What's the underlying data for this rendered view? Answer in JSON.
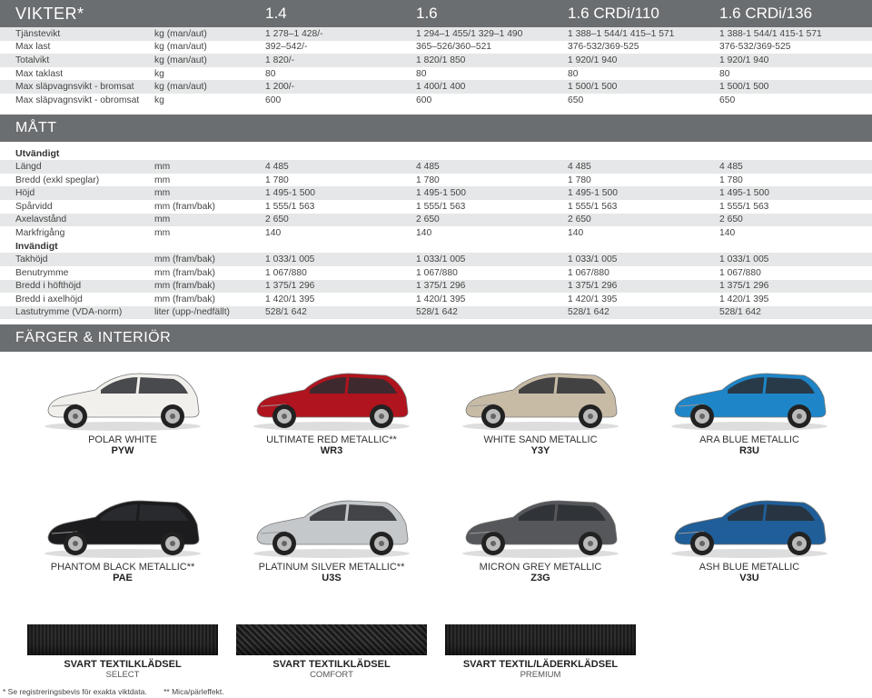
{
  "weights": {
    "title": "VIKTER*",
    "columns": [
      "1.4",
      "1.6",
      "1.6 CRDi/110",
      "1.6 CRDi/136"
    ],
    "rows": [
      [
        "Tjänstevikt",
        "kg (man/aut)",
        "1 278–1 428/-",
        "1 294–1 455/1 329–1 490",
        "1 388–1 544/1 415–1 571",
        "1 388-1 544/1 415-1 571"
      ],
      [
        "Max last",
        "kg (man/aut)",
        "392–542/-",
        "365–526/360–521",
        "376-532/369-525",
        "376-532/369-525"
      ],
      [
        "Totalvikt",
        "kg (man/aut)",
        "1 820/-",
        "1 820/1 850",
        "1 920/1 940",
        "1 920/1 940"
      ],
      [
        "Max taklast",
        "kg",
        "80",
        "80",
        "80",
        "80"
      ],
      [
        "Max släpvagnsvikt - bromsat",
        "kg (man/aut)",
        "1 200/-",
        "1 400/1 400",
        "1 500/1 500",
        "1 500/1 500"
      ],
      [
        "Max släpvagnsvikt - obromsat",
        "kg",
        "600",
        "600",
        "650",
        "650"
      ]
    ]
  },
  "dimensions": {
    "title": "MÅTT",
    "exterior_label": "Utvändigt",
    "exterior": [
      [
        "Längd",
        "mm",
        "4 485",
        "4 485",
        "4 485",
        "4 485"
      ],
      [
        "Bredd (exkl speglar)",
        "mm",
        "1 780",
        "1 780",
        "1 780",
        "1 780"
      ],
      [
        "Höjd",
        "mm",
        "1 495-1 500",
        "1 495-1 500",
        "1 495-1 500",
        "1 495-1 500"
      ],
      [
        "Spårvidd",
        "mm (fram/bak)",
        "1 555/1 563",
        "1 555/1 563",
        "1 555/1 563",
        "1 555/1 563"
      ],
      [
        "Axelavstånd",
        "mm",
        "2 650",
        "2 650",
        "2 650",
        "2 650"
      ],
      [
        "Markfrigång",
        "mm",
        "140",
        "140",
        "140",
        "140"
      ]
    ],
    "interior_label": "Invändigt",
    "interior": [
      [
        "Takhöjd",
        "mm (fram/bak)",
        "1 033/1 005",
        "1 033/1 005",
        "1 033/1 005",
        "1 033/1 005"
      ],
      [
        "Benutrymme",
        "mm (fram/bak)",
        "1 067/880",
        "1 067/880",
        "1 067/880",
        "1 067/880"
      ],
      [
        "Bredd i höfthöjd",
        "mm (fram/bak)",
        "1 375/1 296",
        "1 375/1 296",
        "1 375/1 296",
        "1 375/1 296"
      ],
      [
        "Bredd i axelhöjd",
        "mm (fram/bak)",
        "1 420/1 395",
        "1 420/1 395",
        "1 420/1 395",
        "1 420/1 395"
      ],
      [
        "Lastutrymme (VDA-norm)",
        "liter (upp-/nedfällt)",
        "528/1 642",
        "528/1 642",
        "528/1 642",
        "528/1 642"
      ]
    ]
  },
  "colors": {
    "title": "FÄRGER & INTERIÖR",
    "cars": [
      {
        "name": "POLAR WHITE",
        "code": "PYW",
        "color": "#f1f0ec"
      },
      {
        "name": "ULTIMATE RED METALLIC**",
        "code": "WR3",
        "color": "#b0141e"
      },
      {
        "name": "WHITE SAND METALLIC",
        "code": "Y3Y",
        "color": "#c8bba6"
      },
      {
        "name": "ARA BLUE METALLIC",
        "code": "R3U",
        "color": "#1e86c8"
      },
      {
        "name": "PHANTOM BLACK METALLIC**",
        "code": "PAE",
        "color": "#1c1c1e"
      },
      {
        "name": "PLATINUM SILVER METALLIC**",
        "code": "U3S",
        "color": "#c5c8cb"
      },
      {
        "name": "MICRON GREY METALLIC",
        "code": "Z3G",
        "color": "#55575a"
      },
      {
        "name": "ASH BLUE METALLIC",
        "code": "V3U",
        "color": "#1f5e98"
      }
    ]
  },
  "fabrics": [
    {
      "name": "SVART TEXTILKLÄDSEL",
      "trim": "SELECT"
    },
    {
      "name": "SVART TEXTILKLÄDSEL",
      "trim": "COMFORT"
    },
    {
      "name": "SVART TEXTIL/LÄDERKLÄDSEL",
      "trim": "PREMIUM"
    }
  ],
  "footnotes": [
    "* Se registreringsbevis för exakta viktdata.",
    "** Mica/pärleffekt."
  ]
}
